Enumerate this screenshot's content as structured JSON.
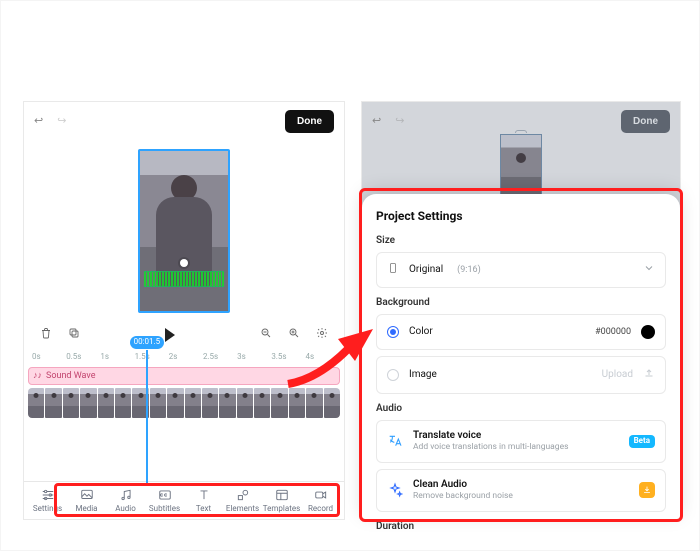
{
  "left": {
    "done": "Done",
    "playhead_label": "00:01.5",
    "ruler": [
      "0s",
      "0.5s",
      "1s",
      "1.5s",
      "2s",
      "2.5s",
      "3s",
      "3.5s",
      "4s"
    ],
    "audio_track_label": "Sound Wave",
    "tabs": [
      {
        "id": "settings",
        "label": "Settings"
      },
      {
        "id": "media",
        "label": "Media"
      },
      {
        "id": "audio",
        "label": "Audio"
      },
      {
        "id": "subtitles",
        "label": "Subtitles"
      },
      {
        "id": "text",
        "label": "Text"
      },
      {
        "id": "elements",
        "label": "Elements"
      },
      {
        "id": "templates",
        "label": "Templates"
      },
      {
        "id": "record",
        "label": "Record"
      }
    ]
  },
  "right": {
    "done": "Done",
    "sheet_title": "Project Settings",
    "sections": {
      "size": {
        "label": "Size",
        "value": "Original",
        "hint": "(9:16)"
      },
      "background": {
        "label": "Background",
        "color_label": "Color",
        "color_value": "#000000",
        "image_label": "Image",
        "image_action": "Upload"
      },
      "audio": {
        "label": "Audio",
        "translate_title": "Translate voice",
        "translate_sub": "Add voice translations in multi-languages",
        "translate_badge": "Beta",
        "clean_title": "Clean Audio",
        "clean_sub": "Remove background noise"
      },
      "duration": {
        "label": "Duration"
      }
    }
  }
}
